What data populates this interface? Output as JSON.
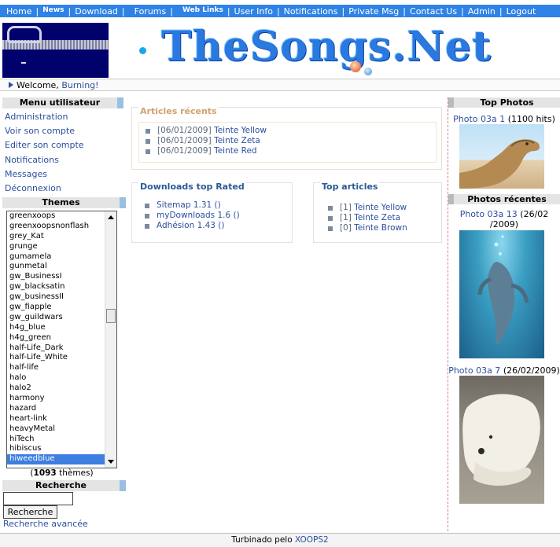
{
  "nav": {
    "items": [
      "Home",
      "News",
      "Download",
      "Forums",
      "Web Links",
      "User Info",
      "Notifications",
      "Private Msg",
      "Contact Us",
      "Admin",
      "Logout"
    ]
  },
  "header": {
    "site_title": "TheSongs.Net"
  },
  "welcome": {
    "prefix": "Welcome,",
    "user": "Burning!"
  },
  "user_menu": {
    "title": "Menu utilisateur",
    "items": [
      "Administration",
      "Voir son compte",
      "Editer son compte",
      "Notifications",
      "Messages",
      "Déconnexion"
    ]
  },
  "themes": {
    "title": "Themes",
    "options": [
      "greenxoops",
      "greenxoopsnonflash",
      "grey_Kat",
      "grunge",
      "gumamela",
      "gunmetal",
      "gw_BusinessI",
      "gw_blacksatin",
      "gw_businessII",
      "gw_fiapple",
      "gw_guildwars",
      "h4g_blue",
      "h4g_green",
      "half-Life_Dark",
      "half-Life_White",
      "half-life",
      "halo",
      "halo2",
      "harmony",
      "hazard",
      "heart-link",
      "heavyMetal",
      "hiTech",
      "hibiscus",
      "hiweedblue"
    ],
    "selected": "hiweedblue",
    "count": "1093",
    "count_suffix": "thèmes"
  },
  "search": {
    "title": "Recherche",
    "input_value": "",
    "button_label": "Recherche",
    "advanced_link": "Recherche avancée"
  },
  "articles_recents": {
    "title": "Articles récents",
    "items": [
      {
        "date": "[06/01/2009]",
        "title": "Teinte Yellow"
      },
      {
        "date": "[06/01/2009]",
        "title": "Teinte Zeta"
      },
      {
        "date": "[06/01/2009]",
        "title": "Teinte Red"
      }
    ]
  },
  "downloads_top_rated": {
    "title": "Downloads top Rated",
    "items": [
      "Sitemap 1.31 ()",
      "myDownloads 1.6 ()",
      "Adhésion 1.43 ()"
    ]
  },
  "top_articles": {
    "title": "Top articles",
    "items": [
      {
        "count": "[1]",
        "title": "Teinte Yellow"
      },
      {
        "count": "[1]",
        "title": "Teinte Zeta"
      },
      {
        "count": "[0]",
        "title": "Teinte Brown"
      }
    ]
  },
  "top_photos": {
    "title": "Top Photos",
    "photo_link": "Photo 03a 1",
    "photo_hits": "(1100 hits)"
  },
  "photos_recentes": {
    "title": "Photos récentes",
    "items": [
      {
        "link": "Photo 03a 13",
        "date_part1": "(26/02",
        "date_part2": "/2009)"
      },
      {
        "link": "Photo 03a 7",
        "date": "(26/02/2009)"
      }
    ]
  },
  "footer": {
    "prefix": "Turbinado pelo",
    "link": "XOOPS2"
  },
  "colors": {
    "nav_bg": "#2f83e6",
    "link": "#2a4f9e",
    "box_title": "#2a5a96",
    "article_title": "#d0a26e",
    "selected_option": "#3d7ee0"
  }
}
